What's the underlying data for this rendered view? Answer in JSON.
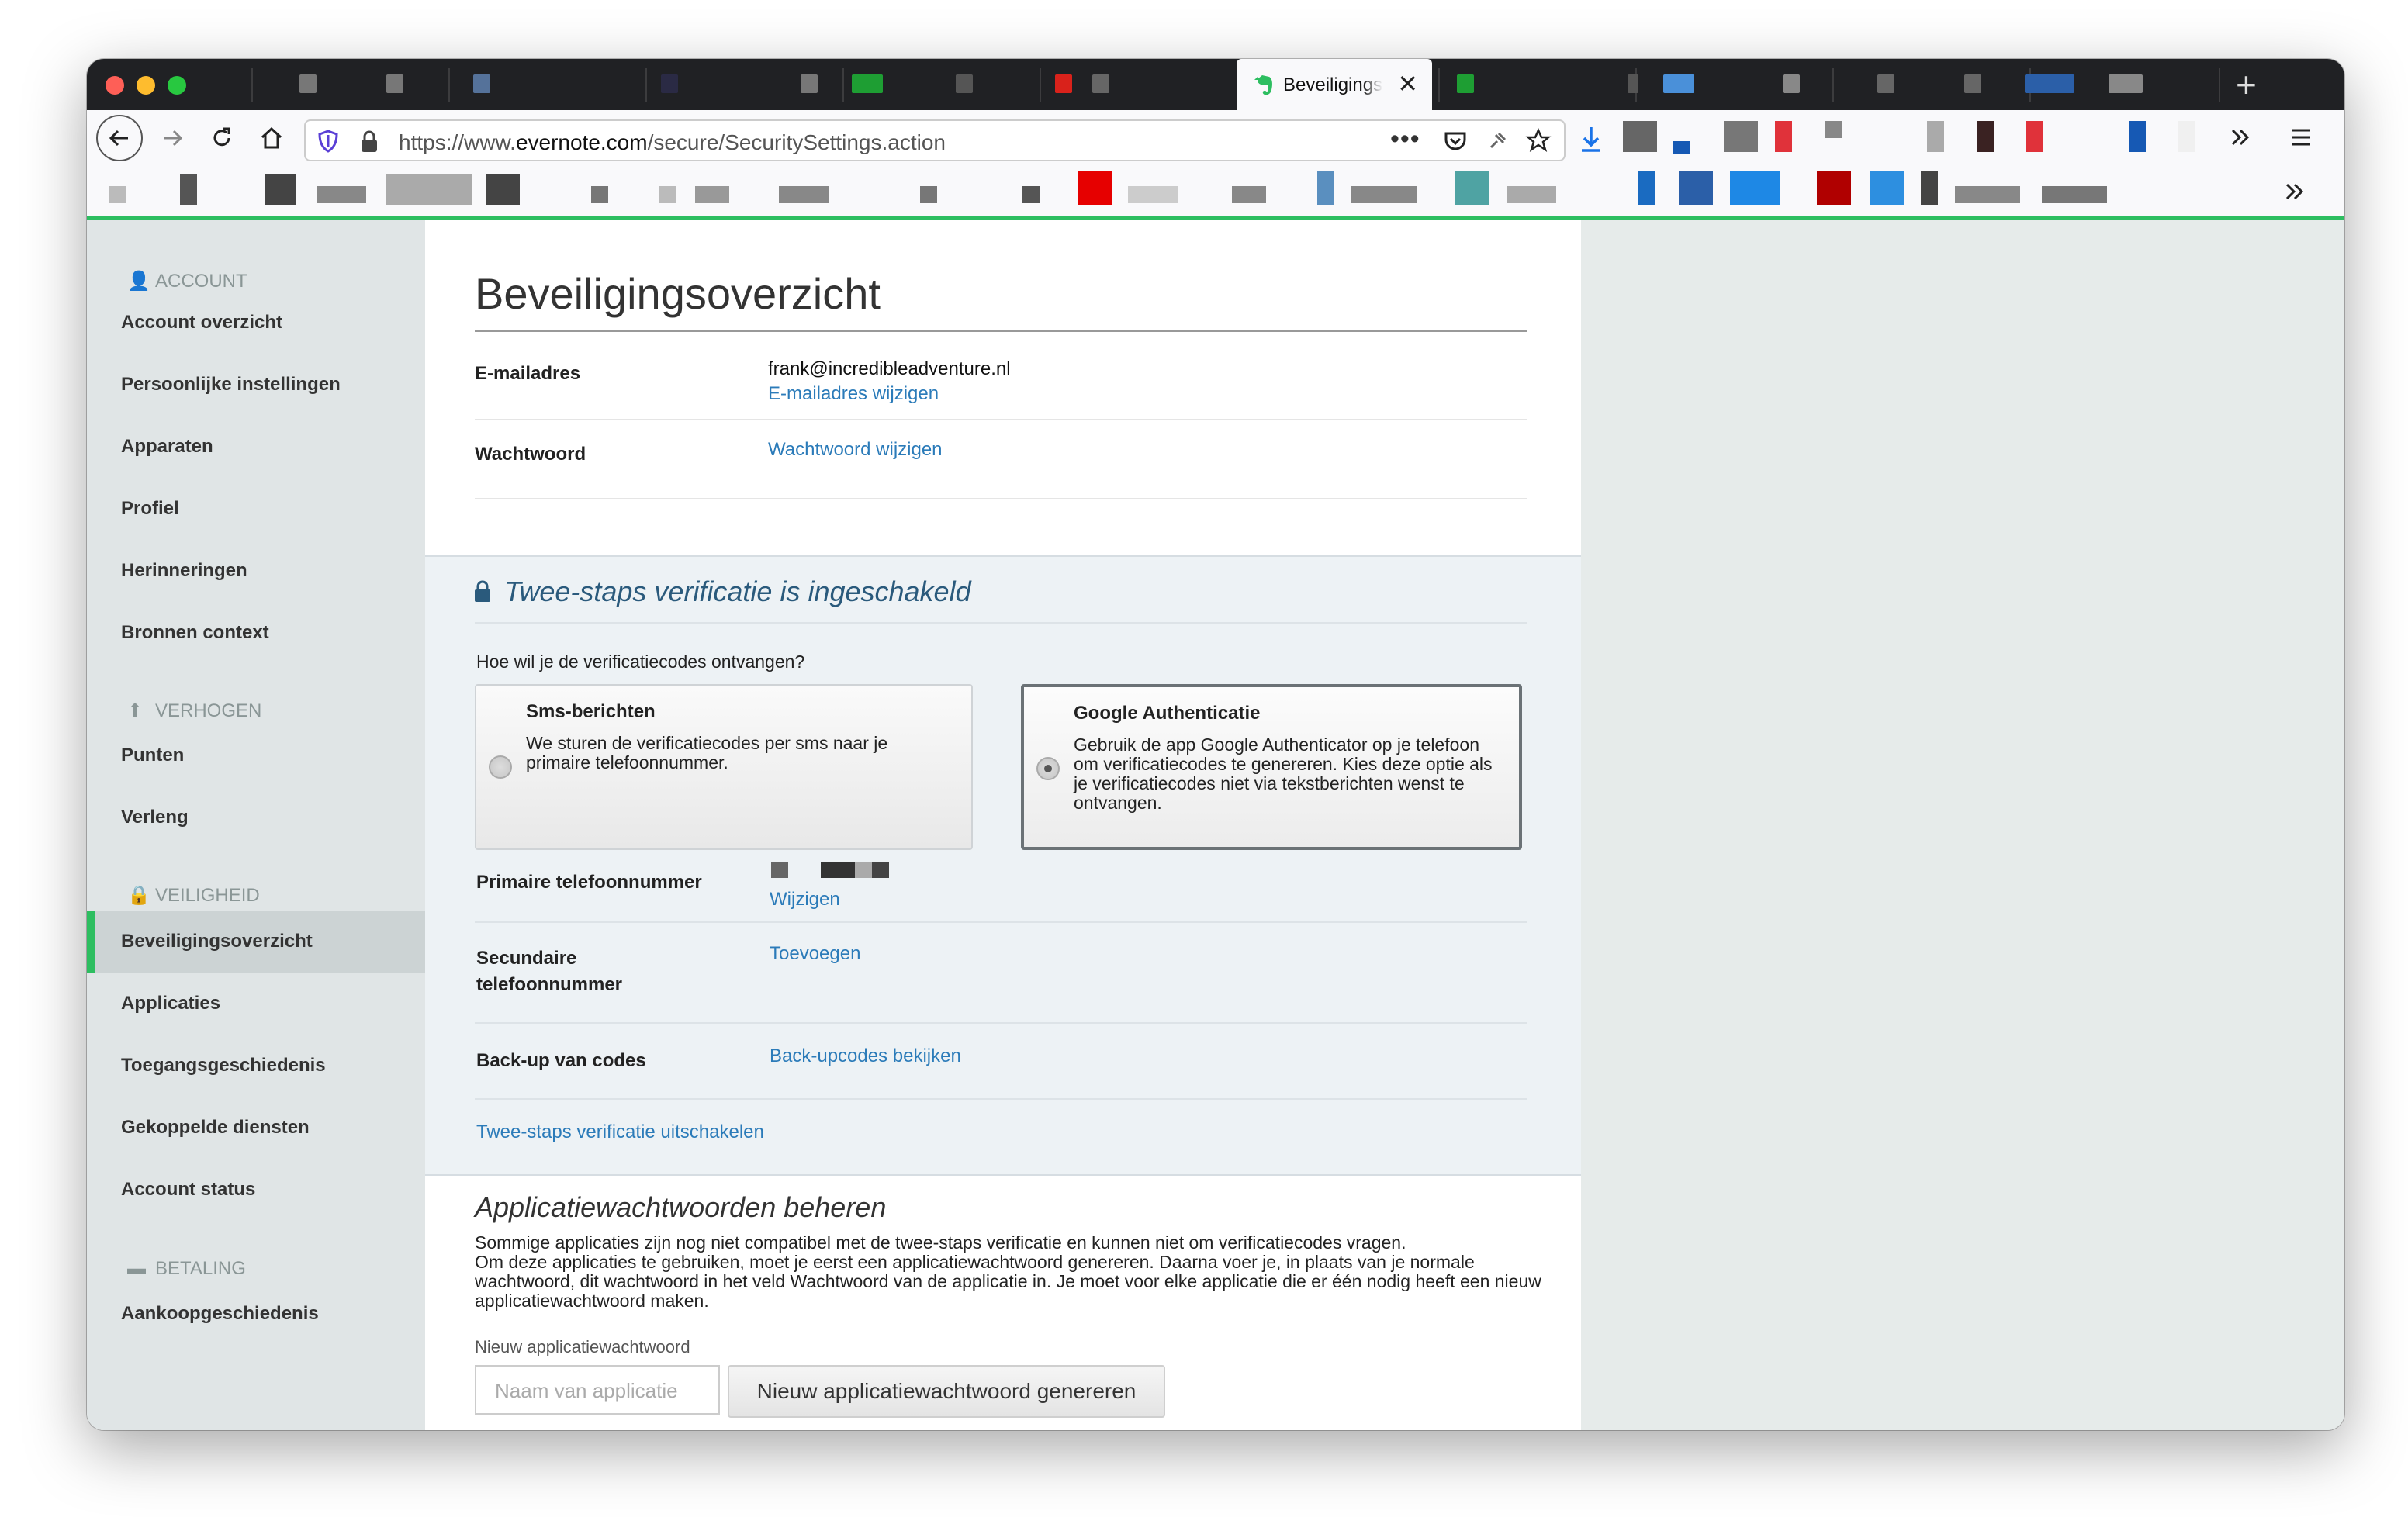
{
  "browser": {
    "active_tab_title": "Beveiligingsoverzicht",
    "url_prefix": "https://www.",
    "url_domain": "evernote.com",
    "url_path": "/secure/SecuritySettings.action"
  },
  "sidebar": {
    "sections": [
      {
        "title": "ACCOUNT",
        "icon": "user-icon",
        "items": [
          "Account overzicht",
          "Persoonlijke instellingen",
          "Apparaten",
          "Profiel",
          "Herinneringen",
          "Bronnen context"
        ]
      },
      {
        "title": "VERHOGEN",
        "icon": "arrow-up-icon",
        "items": [
          "Punten",
          "Verleng"
        ]
      },
      {
        "title": "VEILIGHEID",
        "icon": "lock-icon",
        "items": [
          "Beveiligingsoverzicht",
          "Applicaties",
          "Toegangsgeschiedenis",
          "Gekoppelde diensten",
          "Account status"
        ]
      },
      {
        "title": "BETALING",
        "icon": "card-icon",
        "items": [
          "Aankoopgeschiedenis"
        ]
      }
    ],
    "active_item": "Beveiligingsoverzicht"
  },
  "main": {
    "title": "Beveiligingsoverzicht",
    "email_label": "E-mailadres",
    "email_value": "frank@incredibleadventure.nl",
    "email_change": "E-mailadres wijzigen",
    "password_label": "Wachtwoord",
    "password_change": "Wachtwoord wijzigen"
  },
  "twostep": {
    "title": "Twee-staps verificatie is ingeschakeld",
    "question": "Hoe wil je de verificatiecodes ontvangen?",
    "sms": {
      "title": "Sms-berichten",
      "desc": "We sturen de verificatiecodes per sms naar je primaire telefoonnummer."
    },
    "google": {
      "title": "Google Authenticatie",
      "desc": "Gebruik de app Google Authenticator op je telefoon om verificatiecodes te genereren. Kies deze optie als je verificatiecodes niet via tekstberichten wenst te ontvangen."
    },
    "selected": "Google Authenticatie",
    "primary_label": "Primaire telefoonnummer",
    "primary_change": "Wijzigen",
    "secondary_label_1": "Secundaire",
    "secondary_label_2": "telefoonnummer",
    "secondary_add": "Toevoegen",
    "backup_label": "Back-up van codes",
    "backup_link": "Back-upcodes bekijken",
    "disable_link": "Twee-staps verificatie uitschakelen"
  },
  "apppw": {
    "title": "Applicatiewachtwoorden beheren",
    "para_1": "Sommige applicaties zijn nog niet compatibel met de twee-staps verificatie en kunnen niet om verificatiecodes vragen.",
    "para_2": "Om deze applicaties te gebruiken, moet je eerst een applicatiewachtwoord genereren. Daarna voer je, in plaats van je normale wachtwoord, dit wachtwoord in het veld Wachtwoord van de applicatie in. Je moet voor elke applicatie die er één nodig heeft een nieuw applicatiewachtwoord maken.",
    "field_label": "Nieuw applicatiewachtwoord",
    "placeholder": "Naam van applicatie",
    "button": "Nieuw applicatiewachtwoord genereren"
  },
  "colors": {
    "accent_green": "#2dbe60",
    "link_blue": "#2b7bb9"
  }
}
